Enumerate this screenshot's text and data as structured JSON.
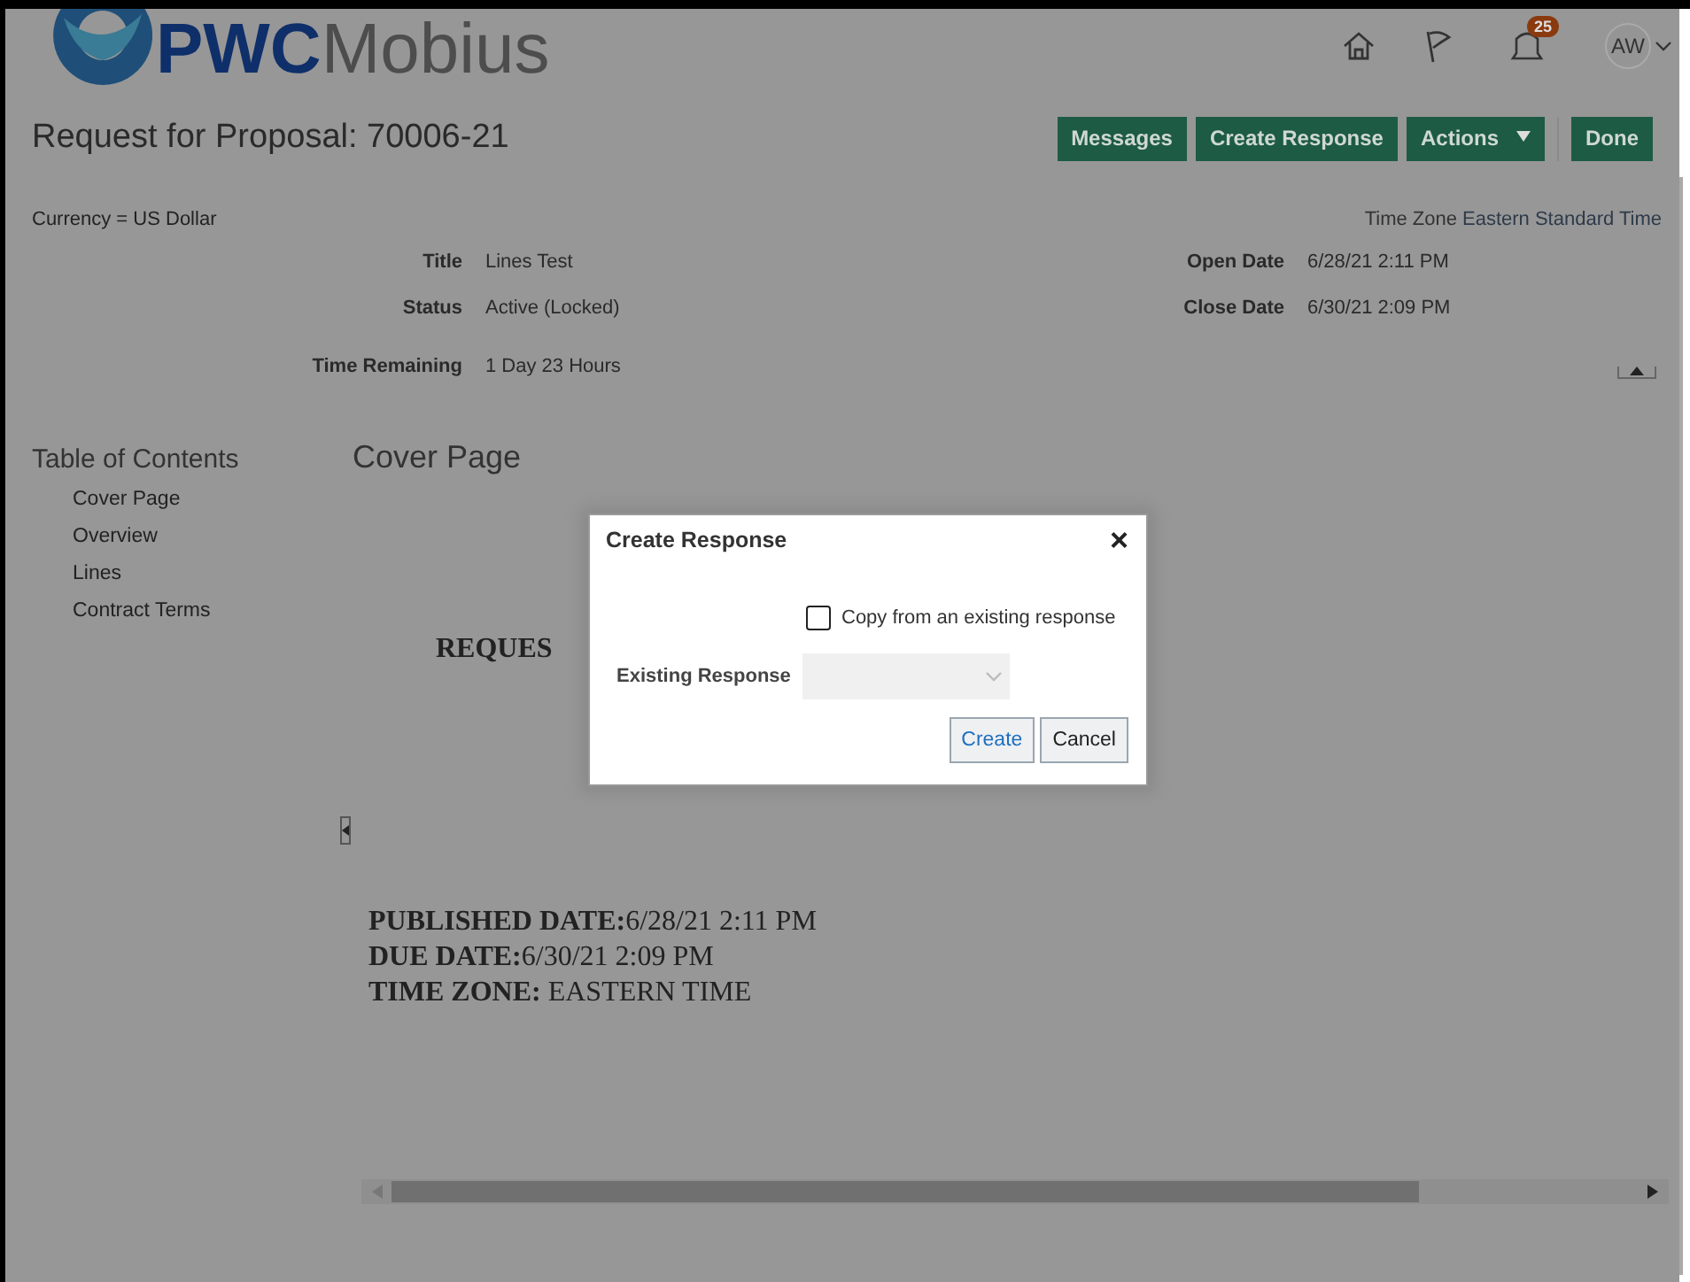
{
  "header": {
    "logo": "**PWC**Mobius",
    "notifications_count": "25",
    "avatar": "AW"
  },
  "page": {
    "title": "Request for Proposal: 70006-21",
    "buttons": [
      {
        "label": "Messages",
        "kind": "button"
      },
      {
        "label": "Create Response",
        "kind": "button"
      },
      {
        "label": "Actions",
        "kind": "menu"
      },
      {
        "label": "Done",
        "kind": "button"
      }
    ]
  },
  "summary": {
    "currency": "Currency = US Dollar",
    "time_zone_label": "Time Zone",
    "time_zone": "Eastern Standard Time",
    "left_fields": [
      {
        "label": "Title",
        "value": "Lines Test"
      },
      {
        "label": "Status",
        "value": "Active (Locked)"
      },
      {
        "label": "Time Remaining",
        "value": "1 Day 23 Hours"
      }
    ],
    "right_fields": [
      {
        "label": "Open Date",
        "value": "6/28/21 2:11 PM"
      },
      {
        "label": "Close Date",
        "value": "6/30/21 2:09 PM"
      }
    ]
  },
  "toc": {
    "title": "Table of Contents",
    "items": [
      "Cover Page",
      "Overview",
      "Lines",
      "Contract Terms"
    ]
  },
  "content": {
    "heading": "Cover Page",
    "cut_heading": "REQUES",
    "details": [
      "**PUBLISHED DATE:**6/28/21 2:11 PM",
      "**DUE DATE:**6/30/21 2:09 PM",
      "**TIME ZONE:** EASTERN TIME"
    ]
  },
  "dialog": {
    "title": "Create Response",
    "close": "×",
    "copy_label": "Copy from an existing response",
    "checked": false,
    "field_label": "Existing Response",
    "field_disabled": true,
    "buttons": [
      {
        "label": "Create",
        "kind": "primary"
      },
      {
        "label": "Cancel",
        "kind": "secondary"
      }
    ]
  }
}
